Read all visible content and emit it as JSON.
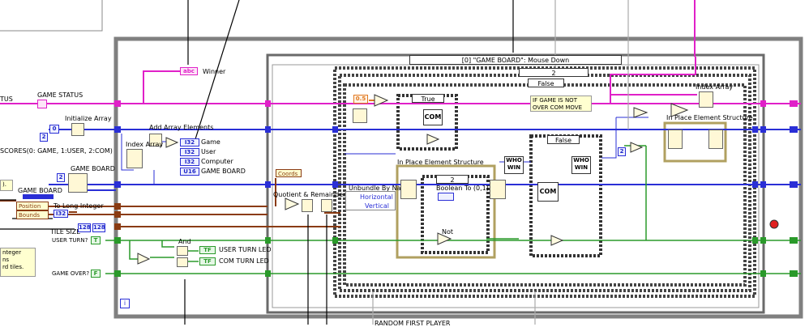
{
  "case_selector": "[0] \"GAME BOARD\": Mouse Down",
  "labels": {
    "winner": "Winner",
    "game_status": "GAME STATUS",
    "tus": "TUS",
    "initialize_array": "Initialize Array",
    "add_array_elements": "Add Array Elements",
    "index_array_left": "Index Array",
    "scores_comment": "SCORES(0: GAME, 1:USER, 2:COM)",
    "game": "Game",
    "user": "User",
    "computer": "Computer",
    "game_board_terminal": "GAME BOARD",
    "game_board_node": "GAME BOARD",
    "game_board_left": "GAME BOARD",
    "coords": "Coords",
    "quotient_remainder": "Quotient & Remainder",
    "position": "Position",
    "bounds": "Bounds",
    "to_long_integer": "To Long Integer",
    "tile_size": "TILE SIZE",
    "user_turn": "USER TURN?",
    "game_over": "GAME OVER?",
    "and": "And",
    "user_turn_led": "USER TURN LED",
    "com_turn_led": "COM TURN LED",
    "unbundle_by_name": "Unbundle By Name",
    "horizontal": "Horizontal",
    "vertical": "Vertical",
    "in_place_left": "In Place Element Structure",
    "boolean_to": "Boolean To (0,1)",
    "not": "Not",
    "who_win_1": "WHO WIN",
    "who_win_2": "WHO WIN",
    "com_1": "COM",
    "com_2": "COM",
    "index_array_right": "Index Array",
    "in_place_right": "In Place Element Structure",
    "if_game_comment": "IF GAME IS NOT OVER COM MOVE",
    "random_first_player": "RANDOM FIRST PLAYER",
    "comment_left": "nteger\nns\nrd tiles.",
    "comment_left2": ").",
    "true_case": "True",
    "false_case_1": "False",
    "false_case_2": "False",
    "case_2a": "2",
    "case_2b": "2",
    "const_05": "0.5",
    "const_0": "0",
    "const_2a": "2",
    "const_2b": "2",
    "const_2c": "2",
    "const_128a": "128",
    "const_128b": "128",
    "i32_game": "I32",
    "i32_user": "I32",
    "i32_comp": "I32",
    "u16": "U16",
    "i32_tl": "I32",
    "tf1": "TF",
    "tf2": "TF",
    "abc": "abc",
    "index_i": "i"
  },
  "colors": {
    "wire_blue": "#2a2fd6",
    "wire_pink": "#e020c8",
    "wire_brown": "#8a3b12",
    "wire_green": "#2a9a2a",
    "wire_orange": "#e07820",
    "frame_gray": "#808080"
  }
}
